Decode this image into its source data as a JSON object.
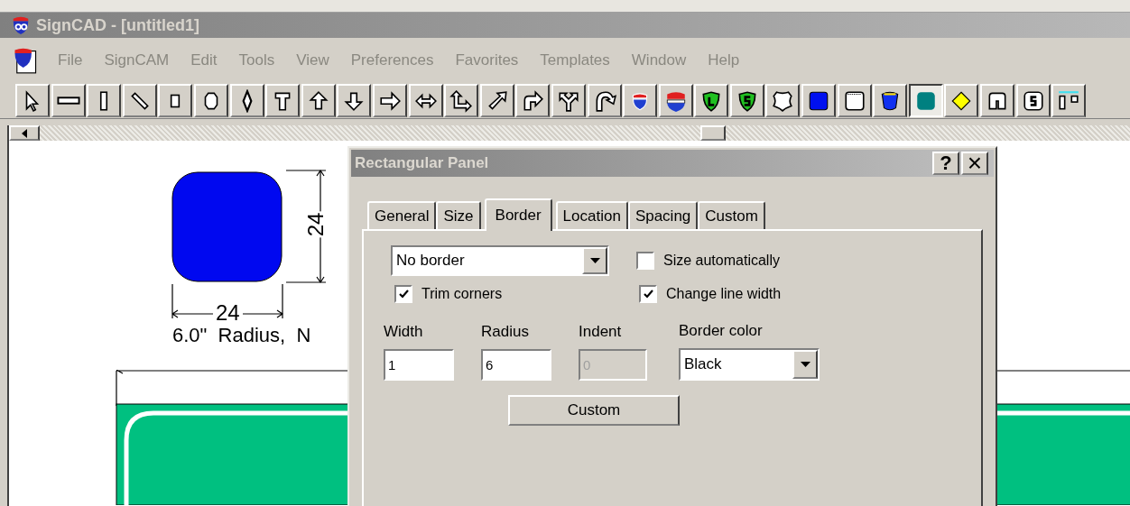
{
  "window": {
    "title": "SignCAD - [untitled1]"
  },
  "menu": [
    "File",
    "SignCAM",
    "Edit",
    "Tools",
    "View",
    "Preferences",
    "Favorites",
    "Templates",
    "Window",
    "Help"
  ],
  "toolbar": [
    {
      "kind": "pointer",
      "selected": false
    },
    {
      "kind": "hline",
      "selected": false
    },
    {
      "kind": "vline",
      "selected": false
    },
    {
      "kind": "diagonal",
      "selected": false
    },
    {
      "kind": "rect",
      "selected": false
    },
    {
      "kind": "octagon",
      "selected": false
    },
    {
      "kind": "diamond",
      "selected": false
    },
    {
      "kind": "text",
      "selected": false
    },
    {
      "kind": "arrow-up",
      "selected": false
    },
    {
      "kind": "arrow-down",
      "selected": false
    },
    {
      "kind": "arrow-right",
      "selected": false
    },
    {
      "kind": "arrow-both",
      "selected": false
    },
    {
      "kind": "arrow-corner",
      "selected": false
    },
    {
      "kind": "arrow-diag",
      "selected": false
    },
    {
      "kind": "arrow-turn",
      "selected": false
    },
    {
      "kind": "arrow-split",
      "selected": false
    },
    {
      "kind": "arrow-curve",
      "selected": false
    },
    {
      "kind": "interstate",
      "selected": false
    },
    {
      "kind": "interstate-wide",
      "selected": false
    },
    {
      "kind": "shield-l",
      "selected": false
    },
    {
      "kind": "shield-s",
      "selected": false
    },
    {
      "kind": "us-shield",
      "selected": false
    },
    {
      "kind": "panel-blue",
      "selected": false
    },
    {
      "kind": "panel-white",
      "selected": false
    },
    {
      "kind": "county",
      "selected": false
    },
    {
      "kind": "panel-teal",
      "selected": true
    },
    {
      "kind": "diamond-yellow",
      "selected": false
    },
    {
      "kind": "tab",
      "selected": false
    },
    {
      "kind": "s-letter",
      "selected": false
    },
    {
      "kind": "two-rect",
      "selected": false
    }
  ],
  "canvas": {
    "height_dimension": "24",
    "width_dimension": "24",
    "caption": "6.0\"  Radius,  N"
  },
  "dialog": {
    "title": "Rectangular Panel",
    "help": "?",
    "close": "×",
    "tabs": [
      {
        "label": "General",
        "selected": false
      },
      {
        "label": "Size",
        "selected": false
      },
      {
        "label": "Border",
        "selected": true
      },
      {
        "label": "Location",
        "selected": false
      },
      {
        "label": "Spacing",
        "selected": false
      },
      {
        "label": "Custom",
        "selected": false
      }
    ],
    "border_style": "No border",
    "checkboxes": [
      {
        "label": "Size automatically",
        "checked": false
      },
      {
        "label": "Trim corners",
        "checked": true
      },
      {
        "label": "Change line width",
        "checked": true
      }
    ],
    "fields": [
      {
        "label": "Width",
        "value": "1",
        "disabled": false
      },
      {
        "label": "Radius",
        "value": "6",
        "disabled": false
      },
      {
        "label": "Indent",
        "value": "0",
        "disabled": true
      }
    ],
    "border_color": {
      "label": "Border color",
      "value": "Black"
    },
    "custom_button": "Custom"
  }
}
